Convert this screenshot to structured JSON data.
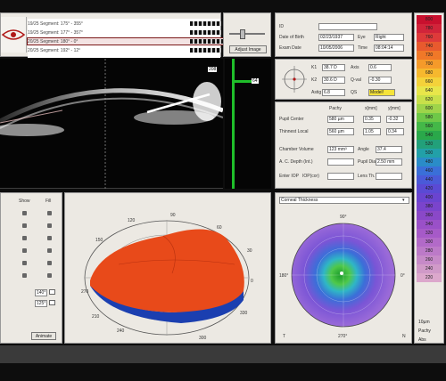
{
  "segments": [
    {
      "num": "19/25",
      "text": "Segment: 175° - 355°"
    },
    {
      "num": "19/25",
      "text": "Segment: 177° - 357°"
    },
    {
      "num": "20/25",
      "text": "Segment: 180° - 0°"
    },
    {
      "num": "20/25",
      "text": "Segment: 192° - 12°"
    }
  ],
  "adjust_image_label": "Adjust Image",
  "scan_badge": "208",
  "density_badge": "64",
  "patient": {
    "dob_label": "Date of Birth",
    "dob": "02/23/1937",
    "eye_label": "Eye",
    "eye": "Right",
    "exam_label": "Exam Date",
    "exam_date": "10/05/2006",
    "time_label": "Time",
    "time": "08:04:14",
    "id_label": "ID"
  },
  "kerato": {
    "k1_label": "K1",
    "k1": "38.7 D",
    "k1_axis_label": "Axis",
    "k1_axis": "0.6",
    "k2_label": "K2",
    "k2": "30.6 D",
    "k2_extra_label": "Q-val",
    "k2_extra": "-0.30",
    "astig_label": "Astig",
    "astig": "6.8",
    "qs_label": "QS",
    "qs": "Model!"
  },
  "pachy": {
    "col_pachy": "Pachy",
    "col_x": "x[mm]",
    "col_y": "y[mm]",
    "pupil_label": "Pupil Center",
    "pupil_pachy": "580 µm",
    "pupil_x": "0.35",
    "pupil_y": "-0.32",
    "thinnest_label": "Thinnest Local",
    "thinnest_pachy": "560 µm",
    "thinnest_x": "1.05",
    "thinnest_y": "0.34",
    "chamber_label": "Chamber Volume",
    "chamber": "123 mm³",
    "angle_label": "Angle",
    "angle": "37.4",
    "acd_label": "A. C. Depth (Int.)",
    "acd": "",
    "pupil_dia_label": "Pupil Dia",
    "pupil_dia": "2.50 mm",
    "iop_label": "Enter IOP",
    "iop_label2": "IOP(cor)",
    "lens_label": "Lens Th.",
    "lens": ""
  },
  "display_select": "Corneal Thickness",
  "three_d": {
    "show_label": "Show",
    "fill_label": "Fill",
    "spin1": "140°",
    "spin2": "125°",
    "animate_label": "Animate",
    "ticks": [
      "90",
      "120",
      "60",
      "150",
      "30",
      "0",
      "330",
      "270",
      "240",
      "300",
      "210"
    ]
  },
  "colormap_ticks": {
    "top": "90°",
    "left": "180°",
    "right": "0°",
    "bottom": "270°",
    "t": "T",
    "n": "N"
  },
  "legend": {
    "values": [
      "800",
      "780",
      "760",
      "740",
      "720",
      "700",
      "680",
      "660",
      "640",
      "620",
      "600",
      "580",
      "560",
      "540",
      "520",
      "500",
      "480",
      "460",
      "440",
      "420",
      "400",
      "380",
      "360",
      "340",
      "320",
      "300",
      "280",
      "260",
      "240",
      "220"
    ],
    "unit": "10µm",
    "mode": "Pachy",
    "abs": "Abs"
  },
  "colors": {
    "panel": "#dcd8cf",
    "accent_red": "#7a1818",
    "surface_orange": "#e84a1a",
    "surface_blue": "#1b3fb0"
  }
}
